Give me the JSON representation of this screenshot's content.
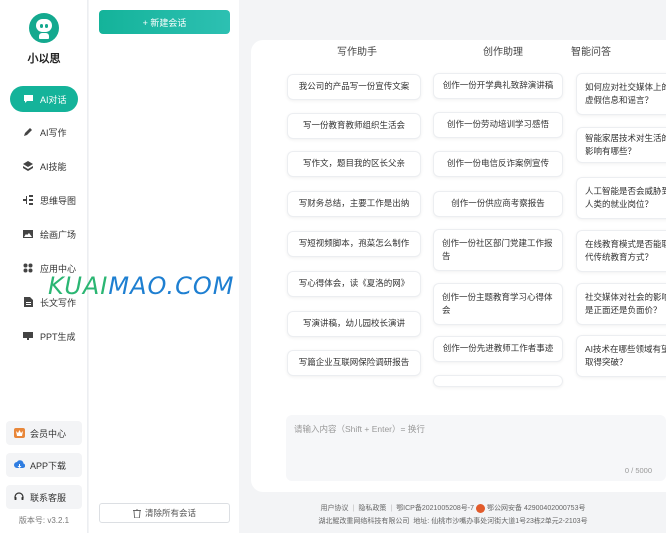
{
  "brand": {
    "name": "小以思"
  },
  "nav": {
    "items": [
      {
        "label": "AI对话",
        "icon": "chat-icon",
        "active": true
      },
      {
        "label": "AI写作",
        "icon": "pen-icon",
        "active": false
      },
      {
        "label": "AI技能",
        "icon": "layers-icon",
        "active": false
      },
      {
        "label": "思维导图",
        "icon": "mindmap-icon",
        "active": false
      },
      {
        "label": "绘画广场",
        "icon": "image-icon",
        "active": false
      },
      {
        "label": "应用中心",
        "icon": "apps-icon",
        "active": false
      },
      {
        "label": "长文写作",
        "icon": "document-icon",
        "active": false
      },
      {
        "label": "PPT生成",
        "icon": "ppt-icon",
        "active": false
      }
    ],
    "member": "会员中心",
    "app_download": "APP下载",
    "support": "联系客服",
    "version": "版本号: v3.2.1"
  },
  "conversations": {
    "new_label": "+ 新建会话",
    "clear_label": "清除所有会话"
  },
  "columns": {
    "headers": [
      "写作助手",
      "创作助理",
      "智能问答"
    ],
    "writing": [
      "我公司的产品写一份宣传文案",
      "写一份教育教师组织生活会",
      "写作文，题目我的区长父亲",
      "写财务总结，主要工作是出纳",
      "写短视频脚本，孢菜怎么制作",
      "写心得体会，读《夏洛的网》",
      "写演讲稿，幼儿园校长演讲",
      "写篇企业互联网保险调研报告"
    ],
    "creation": [
      "创作一份开学典礼致辞演讲稿",
      "创作一份劳动培训学习感悟",
      "创作一份电信反诈案例宣传",
      "创作一份供应商考察报告",
      "创作一份社区部门党建工作报告",
      "创作一份主题教育学习心得体会",
      "创作一份先进教师工作者事迹"
    ],
    "qa": [
      "如何应对社交媒体上的虚假信息和谣言？",
      "智能家居技术对生活的影响有哪些？",
      "人工智能是否会威胁到人类的就业岗位？",
      "在线教育模式是否能取代传统教育方式？",
      "社交媒体对社会的影响是正面还是负面价？",
      "AI技术在哪些领域有望取得突破？"
    ]
  },
  "input": {
    "placeholder": "请输入内容（Shift + Enter）= 换行",
    "counter": "0 / 5000"
  },
  "watermark": {
    "part1": "KUAI",
    "part2": "MAO.COM"
  },
  "footer": {
    "agreement": "用户协议",
    "privacy": "隐私政策",
    "icp": "鄂ICP备2021005208号-7",
    "police": "鄂公网安备 42900402000753号",
    "company": "湖北鲲改重网络科技有限公司",
    "address": "地址: 仙桃市沙嘴办事处河街大道1号23栋2单元2-2103号"
  },
  "colors": {
    "accent": "#14b39a"
  }
}
